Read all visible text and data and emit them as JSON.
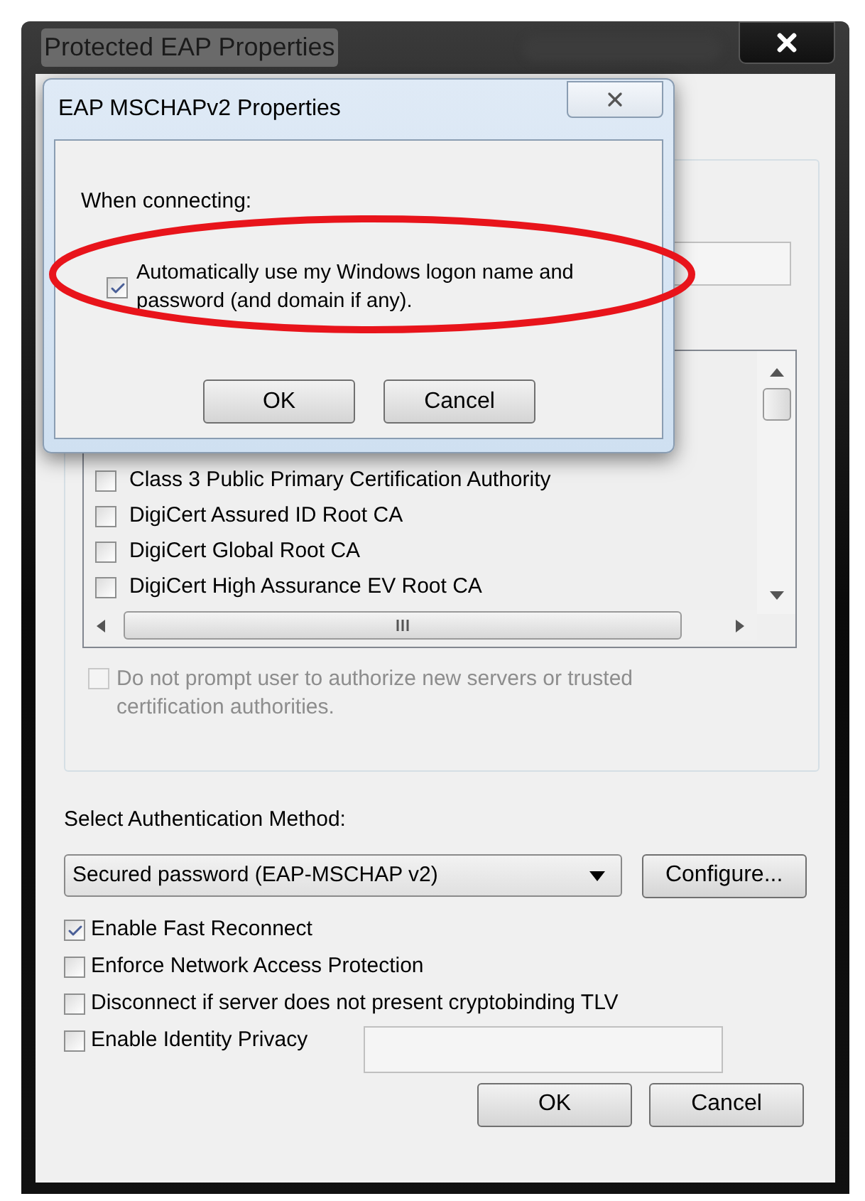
{
  "window": {
    "title": "Protected EAP Properties"
  },
  "certificates": [
    {
      "label": "Class 3 Public Primary Certification Authority",
      "checked": false
    },
    {
      "label": "DigiCert Assured ID Root CA",
      "checked": false
    },
    {
      "label": "DigiCert Global Root CA",
      "checked": false
    },
    {
      "label": "DigiCert High Assurance EV Root CA",
      "checked": false
    }
  ],
  "prompt_option": {
    "label": "Do not prompt user to authorize new servers or trusted certification authorities.",
    "checked": false,
    "disabled": true
  },
  "auth_method": {
    "label": "Select Authentication Method:",
    "value": "Secured password (EAP-MSCHAP v2)",
    "configure": "Configure..."
  },
  "options": [
    {
      "label": "Enable Fast Reconnect",
      "checked": true
    },
    {
      "label": "Enforce Network Access Protection",
      "checked": false
    },
    {
      "label": "Disconnect if server does not present cryptobinding TLV",
      "checked": false
    },
    {
      "label": "Enable Identity Privacy",
      "checked": false,
      "kind": "with_field"
    }
  ],
  "buttons": [
    "OK",
    "Cancel"
  ],
  "dialog": {
    "title": "EAP MSCHAPv2 Properties",
    "heading": "When connecting:",
    "option": {
      "label": "Automatically use my Windows logon name and password (and domain if any).",
      "checked": true
    },
    "buttons": [
      "OK",
      "Cancel"
    ]
  }
}
